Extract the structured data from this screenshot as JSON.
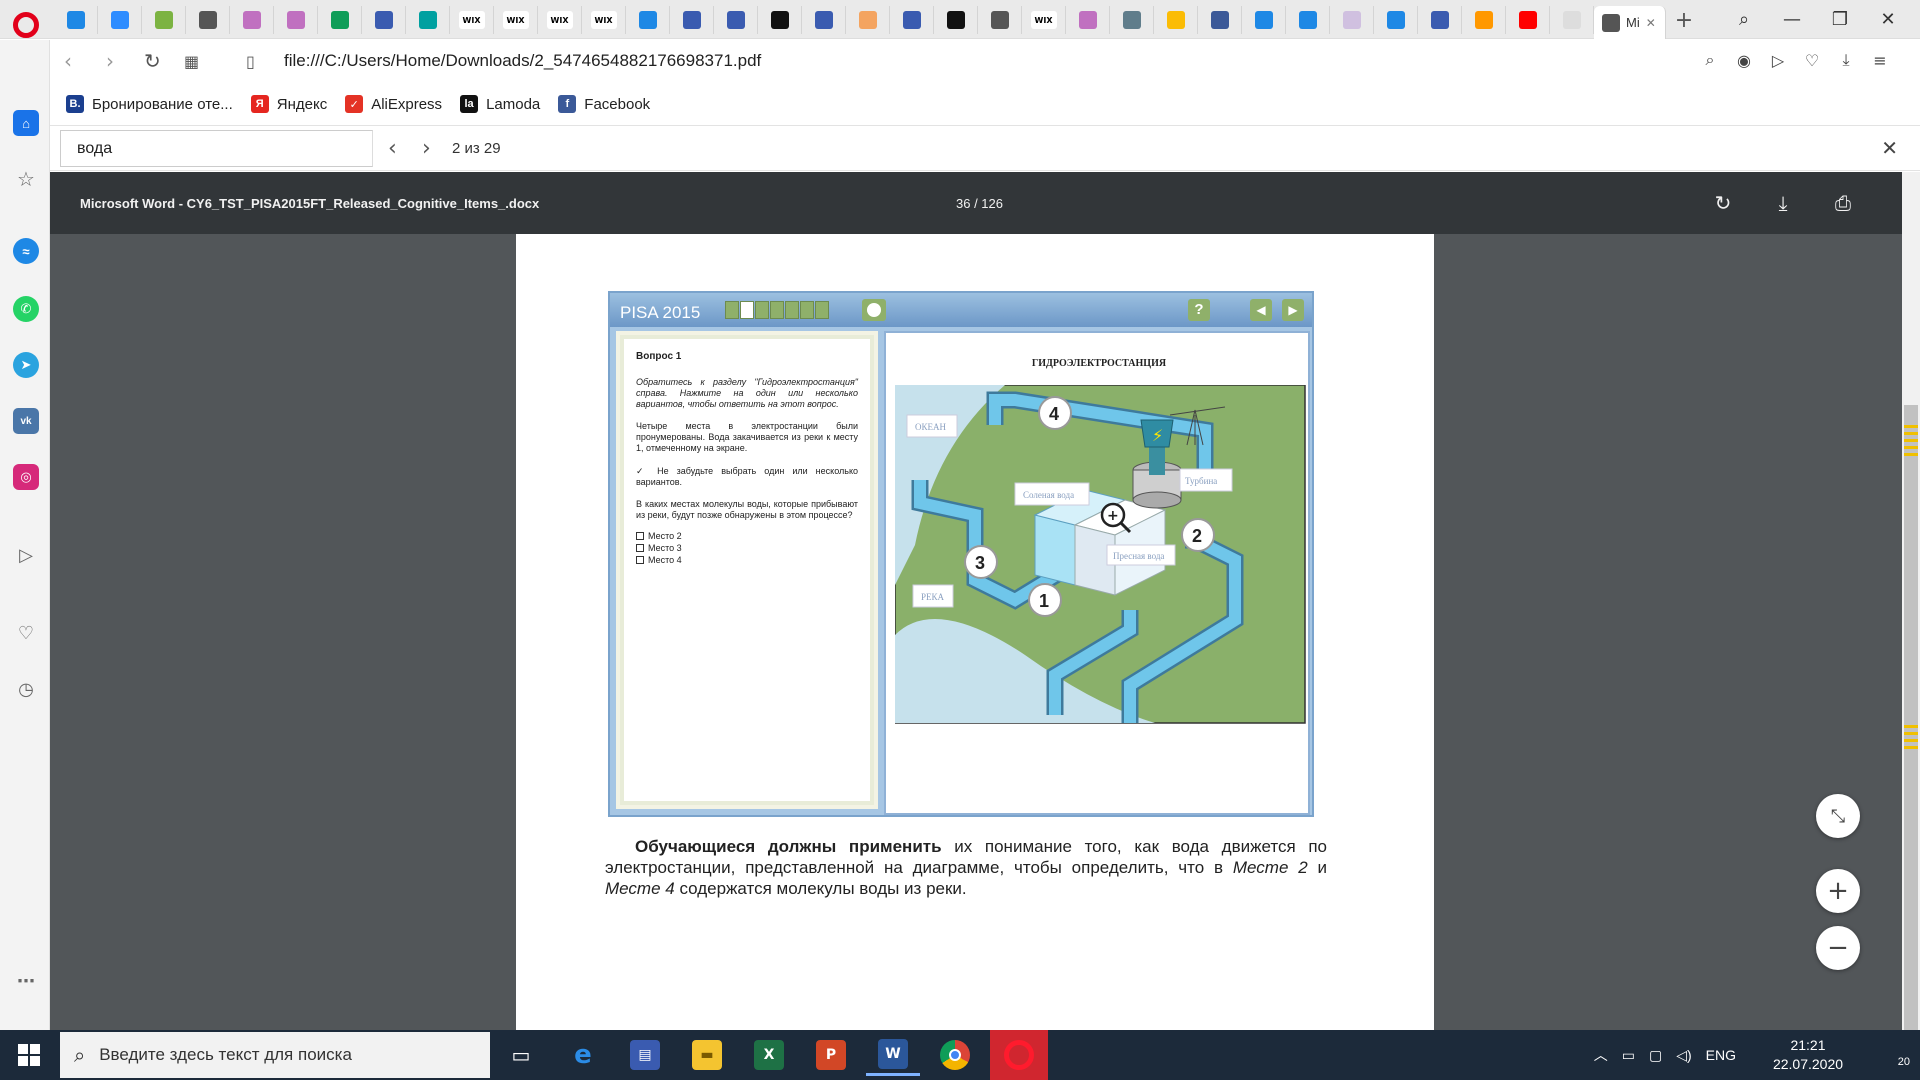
{
  "browser": {
    "active_tab_title": "Mi",
    "url": "file:///C:/Users/Home/Downloads/2_5474654882176698371.pdf",
    "tab_icons": [
      "mail-tab",
      "zoom-tab",
      "leaf-tab",
      "doc-tab",
      "mushroom-tab",
      "mushroom-tab",
      "plus-tab",
      "form-tab",
      "swirl-tab",
      "wix-tab",
      "wix-tab",
      "wix-tab",
      "wix-tab",
      "layout-tab",
      "form-tab",
      "form-tab",
      "ring-tab",
      "form-tab",
      "avatar-tab",
      "form-tab",
      "ring-tab",
      "doc-tab",
      "wix-tab",
      "mushroom-tab",
      "puzzle-tab",
      "drive-tab",
      "facebook-tab",
      "c-tab",
      "c-tab",
      "image-tab",
      "layout-tab",
      "form-tab",
      "colorful-tab",
      "youtube-tab",
      "blank-tab"
    ],
    "wix_label": "WIX",
    "bookmarks": [
      {
        "icon": "booking-icon",
        "glyph": "B.",
        "label": "Бронирование оте...",
        "color": "#1b3f8f"
      },
      {
        "icon": "yandex-icon",
        "glyph": "Я",
        "label": "Яндекс",
        "color": "#e52620"
      },
      {
        "icon": "aliexpress-icon",
        "glyph": "✓",
        "label": "AliExpress",
        "color": "#e43225"
      },
      {
        "icon": "lamoda-icon",
        "glyph": "la",
        "label": "Lamoda",
        "color": "#111111"
      },
      {
        "icon": "facebook-icon",
        "glyph": "f",
        "label": "Facebook",
        "color": "#3b5998"
      }
    ]
  },
  "find": {
    "query": "вода",
    "count": "2 из 29"
  },
  "pdf": {
    "title": "Microsoft Word - CY6_TST_PISA2015FT_Released_Cognitive_Items_.docx",
    "page_indicator": "36 / 126"
  },
  "figure": {
    "header": "PISA 2015",
    "question_title": "Вопрос 1",
    "instructions": "Обратитесь к разделу \"Гидроэлектростанция\" справа. Нажмите на один или несколько вариантов, чтобы ответить на этот вопрос.",
    "para1": "Четыре места в электростанции были пронумерованы. Вода закачивается из реки к месту 1, отмеченному на экране.",
    "para2": "✓  Не забудьте выбрать один или несколько вариантов.",
    "para3": "В каких местах молекулы воды, которые прибывают из реки, будут позже обнаружены в этом процессе?",
    "options": [
      "Место 2",
      "Место 3",
      "Место 4"
    ],
    "diagram_title": "ГИДРОЭЛЕКТРОСТАНЦИЯ",
    "labels": {
      "ocean": "ОКЕАН",
      "salt_water": "Соленая вода",
      "turbine": "Турбина",
      "fresh_water": "Пресная вода",
      "river": "РЕКА"
    },
    "place_numbers": [
      "1",
      "2",
      "3",
      "4"
    ]
  },
  "body": {
    "bold_lead": "Обучающиеся должны применить",
    "text1": " их понимание того, как вода движется по электростанции, представленной на диаграмме, чтобы определить, что в ",
    "place2": "Месте 2",
    "and": " и ",
    "place4": "Месте 4",
    "text2": " содержатся молекулы воды из реки."
  },
  "taskbar": {
    "search_placeholder": "Введите здесь текст для поиска",
    "apps": [
      "edge-icon",
      "save-icon",
      "explorer-icon",
      "excel-icon",
      "powerpoint-icon",
      "word-icon",
      "chrome-icon",
      "opera-icon"
    ],
    "lang": "ENG",
    "time": "21:21",
    "date": "22.07.2020",
    "notifications": "20"
  },
  "colors": {
    "opera_red": "#e2001a",
    "pdf_toolbar": "#323639",
    "viewer_bg": "#525659",
    "taskbar": "#1c2a3a",
    "pipe_blue": "#5ab4dc",
    "land_green": "#8ab06a"
  }
}
